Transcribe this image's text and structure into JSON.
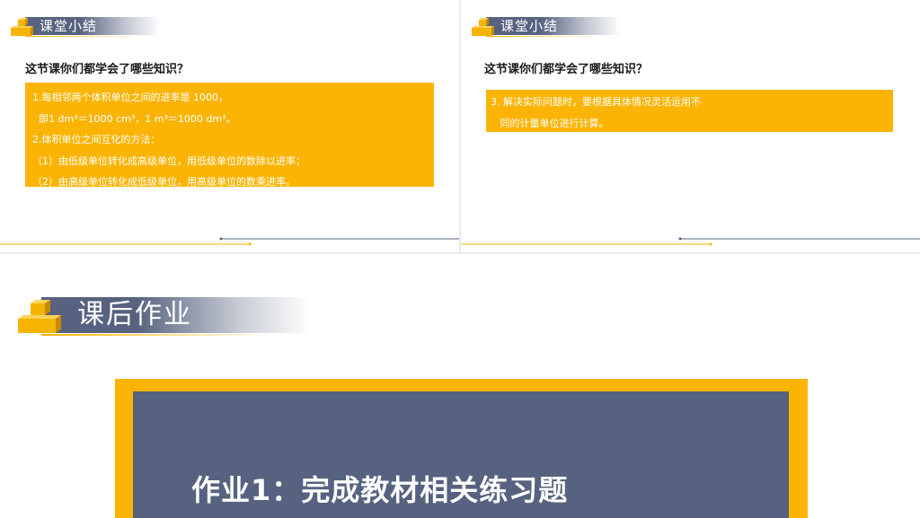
{
  "slides": [
    {
      "header": "课堂小结",
      "question": "这节课你们都学会了哪些知识？",
      "lines": [
        "1.每相邻两个体积单位之间的进率是 1000，",
        "  即1 dm³＝1000 cm³，1 m³＝1000 dm³。",
        "2.体积单位之间互化的方法：",
        "（1）由低级单位转化成高级单位，用低级单位的数除以进率；",
        "（2）由高级单位转化成低级单位，用高级单位的数乘进率。"
      ]
    },
    {
      "header": "课堂小结",
      "question": "这节课你们都学会了哪些知识？",
      "lines": [
        "3. 解决实际问题时，要根据具体情况灵活运用不",
        "   同的计量单位进行计算。"
      ]
    },
    {
      "header": "课后作业",
      "homework": "作业1：完成教材相关练习题"
    }
  ],
  "colors": {
    "accent": "#fbb404",
    "slate": "#56627f"
  },
  "icons": {
    "header": "stacked-cubes-icon"
  }
}
